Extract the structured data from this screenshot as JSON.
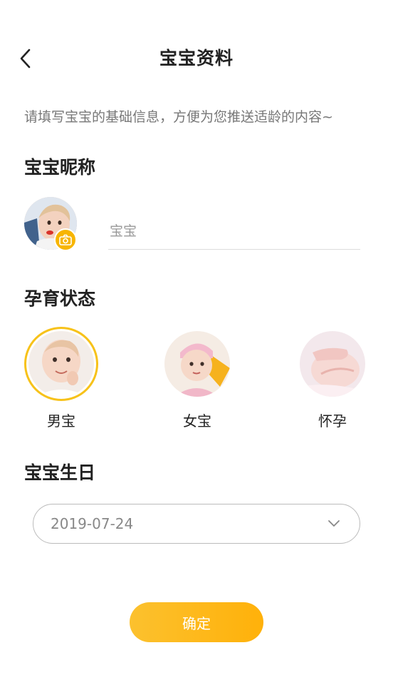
{
  "header": {
    "title": "宝宝资料"
  },
  "hint": "请填写宝宝的基础信息，方便为您推送适龄的内容~",
  "nickname": {
    "section_title": "宝宝昵称",
    "placeholder": "宝宝",
    "value": ""
  },
  "status": {
    "section_title": "孕育状态",
    "options": [
      {
        "label": "男宝",
        "selected": true
      },
      {
        "label": "女宝",
        "selected": false
      },
      {
        "label": "怀孕",
        "selected": false
      }
    ]
  },
  "birthday": {
    "section_title": "宝宝生日",
    "value": "2019-07-24"
  },
  "confirm": {
    "label": "确定"
  },
  "colors": {
    "accent": "#f7c21a",
    "button": "#ffb10a",
    "hint_text": "#777777"
  }
}
